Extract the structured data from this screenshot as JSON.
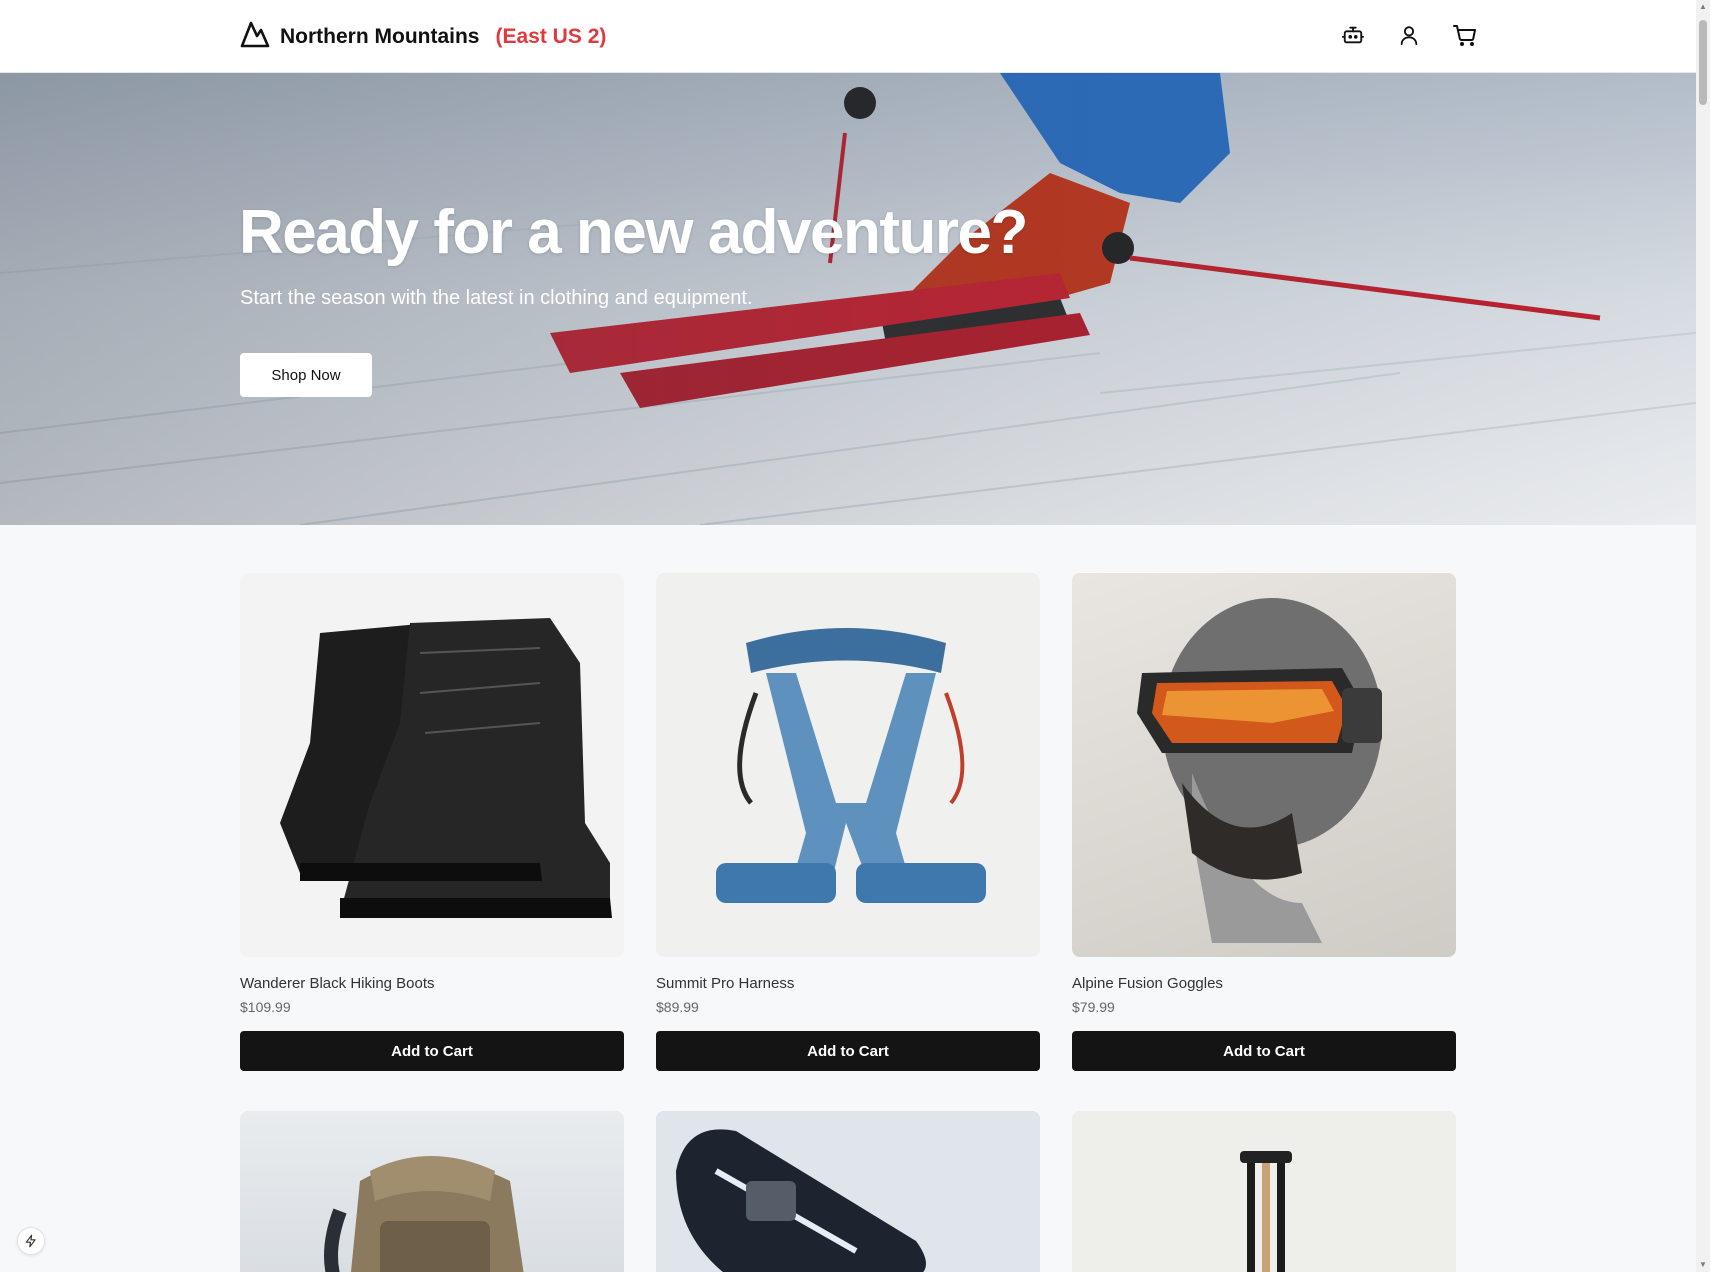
{
  "header": {
    "brand_name": "Northern Mountains",
    "region": "(East US 2)",
    "region_color": "#e03a3e",
    "icons": [
      "robot-icon",
      "user-icon",
      "cart-icon"
    ]
  },
  "hero": {
    "title": "Ready for a new adventure?",
    "subtitle": "Start the season with the latest in clothing and equipment.",
    "cta_label": "Shop Now"
  },
  "products": [
    {
      "name": "Wanderer Black Hiking Boots",
      "price": "$109.99",
      "button": "Add to Cart"
    },
    {
      "name": "Summit Pro Harness",
      "price": "$89.99",
      "button": "Add to Cart"
    },
    {
      "name": "Alpine Fusion Goggles",
      "price": "$79.99",
      "button": "Add to Cart"
    }
  ]
}
